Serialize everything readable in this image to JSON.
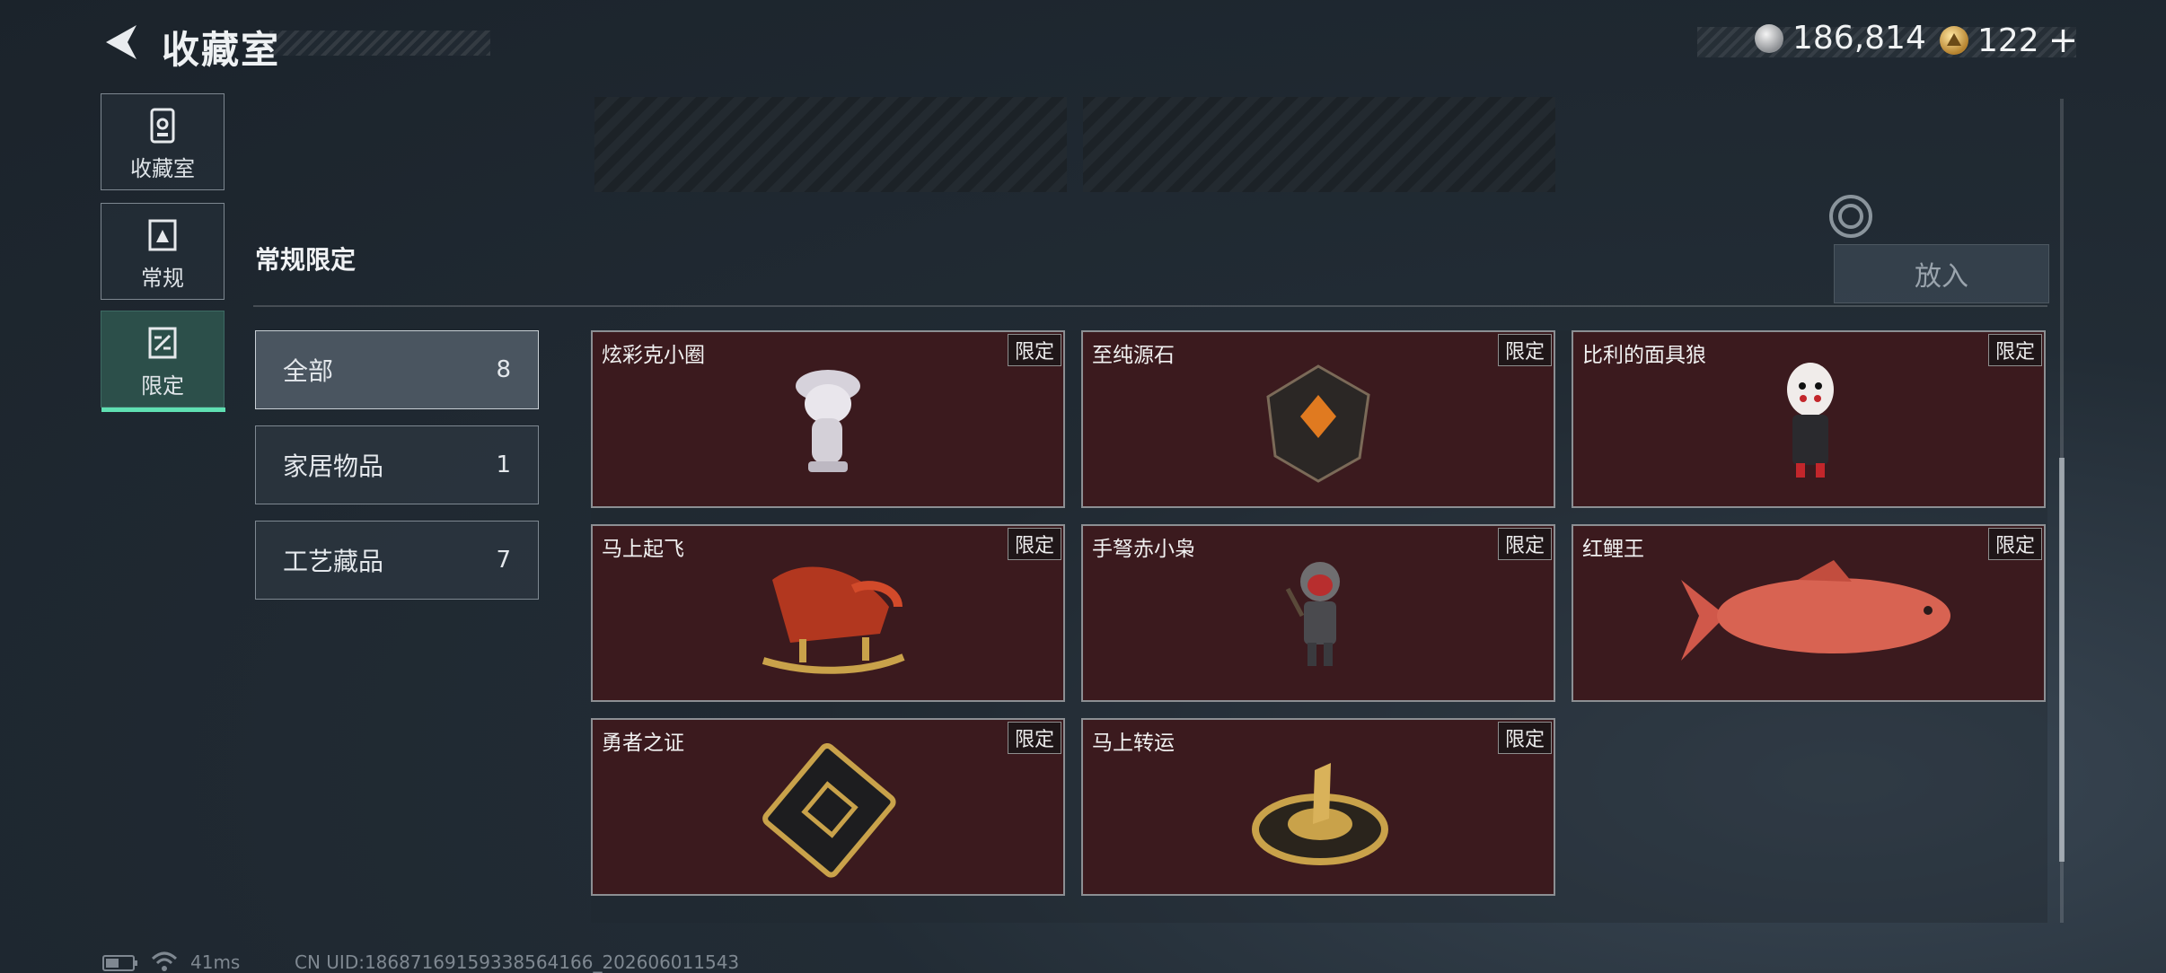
{
  "header": {
    "title": "收藏室",
    "currency1": "186,814",
    "currency2": "122",
    "plus": "+"
  },
  "nav": [
    {
      "label": "收藏室",
      "icon": "collection-icon"
    },
    {
      "label": "常规",
      "icon": "regular-icon"
    },
    {
      "label": "限定",
      "icon": "limited-icon",
      "active": true
    }
  ],
  "section": {
    "title": "常规限定",
    "put_button": "放入"
  },
  "categories": [
    {
      "label": "全部",
      "count": "8"
    },
    {
      "label": "家居物品",
      "count": "1"
    },
    {
      "label": "工艺藏品",
      "count": "7"
    }
  ],
  "items": [
    {
      "name": "炫彩克小圈",
      "tag": "限定"
    },
    {
      "name": "至纯源石",
      "tag": "限定"
    },
    {
      "name": "比利的面具狼",
      "tag": "限定"
    },
    {
      "name": "马上起飞",
      "tag": "限定"
    },
    {
      "name": "手弩赤小枭",
      "tag": "限定"
    },
    {
      "name": "红鲤王",
      "tag": "限定"
    },
    {
      "name": "勇者之证",
      "tag": "限定"
    },
    {
      "name": "马上转运",
      "tag": "限定"
    }
  ],
  "footer": {
    "ping": "41ms",
    "uid": "CN UID:18687169159338564166_202606011543"
  },
  "colors": {
    "accent": "#5fe0b2",
    "card_bg": "#3b1a1e"
  }
}
